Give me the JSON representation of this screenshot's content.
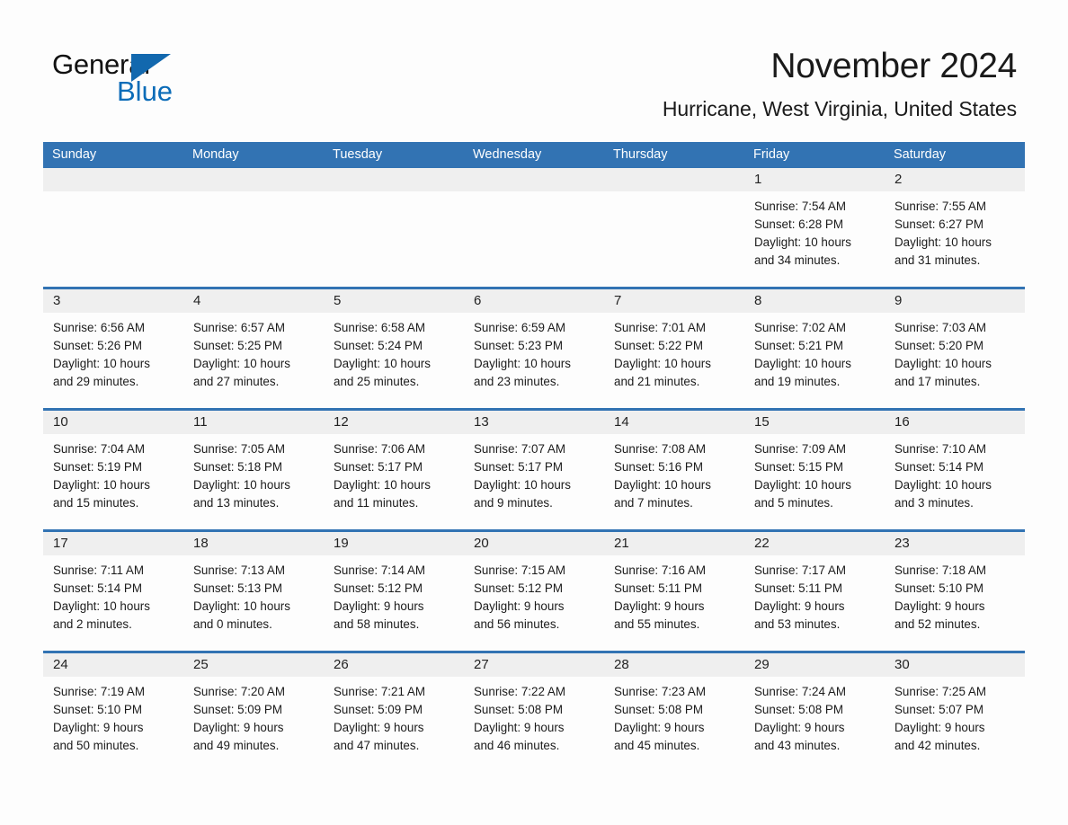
{
  "brand": {
    "name_part1": "General",
    "name_part2": "Blue",
    "accent_color": "#1268ae",
    "triangle_icon": "triangle-icon"
  },
  "header": {
    "month_title": "November 2024",
    "location": "Hurricane, West Virginia, United States"
  },
  "theme": {
    "header_blue": "#3273b3",
    "daynum_band": "#efefef",
    "page_background": "#fdfdfd"
  },
  "weekdays": [
    "Sunday",
    "Monday",
    "Tuesday",
    "Wednesday",
    "Thursday",
    "Friday",
    "Saturday"
  ],
  "weeks": [
    [
      {
        "empty": true
      },
      {
        "empty": true
      },
      {
        "empty": true
      },
      {
        "empty": true
      },
      {
        "empty": true
      },
      {
        "day": "1",
        "sunrise": "Sunrise: 7:54 AM",
        "sunset": "Sunset: 6:28 PM",
        "daylight_line1": "Daylight: 10 hours",
        "daylight_line2": "and 34 minutes."
      },
      {
        "day": "2",
        "sunrise": "Sunrise: 7:55 AM",
        "sunset": "Sunset: 6:27 PM",
        "daylight_line1": "Daylight: 10 hours",
        "daylight_line2": "and 31 minutes."
      }
    ],
    [
      {
        "day": "3",
        "sunrise": "Sunrise: 6:56 AM",
        "sunset": "Sunset: 5:26 PM",
        "daylight_line1": "Daylight: 10 hours",
        "daylight_line2": "and 29 minutes."
      },
      {
        "day": "4",
        "sunrise": "Sunrise: 6:57 AM",
        "sunset": "Sunset: 5:25 PM",
        "daylight_line1": "Daylight: 10 hours",
        "daylight_line2": "and 27 minutes."
      },
      {
        "day": "5",
        "sunrise": "Sunrise: 6:58 AM",
        "sunset": "Sunset: 5:24 PM",
        "daylight_line1": "Daylight: 10 hours",
        "daylight_line2": "and 25 minutes."
      },
      {
        "day": "6",
        "sunrise": "Sunrise: 6:59 AM",
        "sunset": "Sunset: 5:23 PM",
        "daylight_line1": "Daylight: 10 hours",
        "daylight_line2": "and 23 minutes."
      },
      {
        "day": "7",
        "sunrise": "Sunrise: 7:01 AM",
        "sunset": "Sunset: 5:22 PM",
        "daylight_line1": "Daylight: 10 hours",
        "daylight_line2": "and 21 minutes."
      },
      {
        "day": "8",
        "sunrise": "Sunrise: 7:02 AM",
        "sunset": "Sunset: 5:21 PM",
        "daylight_line1": "Daylight: 10 hours",
        "daylight_line2": "and 19 minutes."
      },
      {
        "day": "9",
        "sunrise": "Sunrise: 7:03 AM",
        "sunset": "Sunset: 5:20 PM",
        "daylight_line1": "Daylight: 10 hours",
        "daylight_line2": "and 17 minutes."
      }
    ],
    [
      {
        "day": "10",
        "sunrise": "Sunrise: 7:04 AM",
        "sunset": "Sunset: 5:19 PM",
        "daylight_line1": "Daylight: 10 hours",
        "daylight_line2": "and 15 minutes."
      },
      {
        "day": "11",
        "sunrise": "Sunrise: 7:05 AM",
        "sunset": "Sunset: 5:18 PM",
        "daylight_line1": "Daylight: 10 hours",
        "daylight_line2": "and 13 minutes."
      },
      {
        "day": "12",
        "sunrise": "Sunrise: 7:06 AM",
        "sunset": "Sunset: 5:17 PM",
        "daylight_line1": "Daylight: 10 hours",
        "daylight_line2": "and 11 minutes."
      },
      {
        "day": "13",
        "sunrise": "Sunrise: 7:07 AM",
        "sunset": "Sunset: 5:17 PM",
        "daylight_line1": "Daylight: 10 hours",
        "daylight_line2": "and 9 minutes."
      },
      {
        "day": "14",
        "sunrise": "Sunrise: 7:08 AM",
        "sunset": "Sunset: 5:16 PM",
        "daylight_line1": "Daylight: 10 hours",
        "daylight_line2": "and 7 minutes."
      },
      {
        "day": "15",
        "sunrise": "Sunrise: 7:09 AM",
        "sunset": "Sunset: 5:15 PM",
        "daylight_line1": "Daylight: 10 hours",
        "daylight_line2": "and 5 minutes."
      },
      {
        "day": "16",
        "sunrise": "Sunrise: 7:10 AM",
        "sunset": "Sunset: 5:14 PM",
        "daylight_line1": "Daylight: 10 hours",
        "daylight_line2": "and 3 minutes."
      }
    ],
    [
      {
        "day": "17",
        "sunrise": "Sunrise: 7:11 AM",
        "sunset": "Sunset: 5:14 PM",
        "daylight_line1": "Daylight: 10 hours",
        "daylight_line2": "and 2 minutes."
      },
      {
        "day": "18",
        "sunrise": "Sunrise: 7:13 AM",
        "sunset": "Sunset: 5:13 PM",
        "daylight_line1": "Daylight: 10 hours",
        "daylight_line2": "and 0 minutes."
      },
      {
        "day": "19",
        "sunrise": "Sunrise: 7:14 AM",
        "sunset": "Sunset: 5:12 PM",
        "daylight_line1": "Daylight: 9 hours",
        "daylight_line2": "and 58 minutes."
      },
      {
        "day": "20",
        "sunrise": "Sunrise: 7:15 AM",
        "sunset": "Sunset: 5:12 PM",
        "daylight_line1": "Daylight: 9 hours",
        "daylight_line2": "and 56 minutes."
      },
      {
        "day": "21",
        "sunrise": "Sunrise: 7:16 AM",
        "sunset": "Sunset: 5:11 PM",
        "daylight_line1": "Daylight: 9 hours",
        "daylight_line2": "and 55 minutes."
      },
      {
        "day": "22",
        "sunrise": "Sunrise: 7:17 AM",
        "sunset": "Sunset: 5:11 PM",
        "daylight_line1": "Daylight: 9 hours",
        "daylight_line2": "and 53 minutes."
      },
      {
        "day": "23",
        "sunrise": "Sunrise: 7:18 AM",
        "sunset": "Sunset: 5:10 PM",
        "daylight_line1": "Daylight: 9 hours",
        "daylight_line2": "and 52 minutes."
      }
    ],
    [
      {
        "day": "24",
        "sunrise": "Sunrise: 7:19 AM",
        "sunset": "Sunset: 5:10 PM",
        "daylight_line1": "Daylight: 9 hours",
        "daylight_line2": "and 50 minutes."
      },
      {
        "day": "25",
        "sunrise": "Sunrise: 7:20 AM",
        "sunset": "Sunset: 5:09 PM",
        "daylight_line1": "Daylight: 9 hours",
        "daylight_line2": "and 49 minutes."
      },
      {
        "day": "26",
        "sunrise": "Sunrise: 7:21 AM",
        "sunset": "Sunset: 5:09 PM",
        "daylight_line1": "Daylight: 9 hours",
        "daylight_line2": "and 47 minutes."
      },
      {
        "day": "27",
        "sunrise": "Sunrise: 7:22 AM",
        "sunset": "Sunset: 5:08 PM",
        "daylight_line1": "Daylight: 9 hours",
        "daylight_line2": "and 46 minutes."
      },
      {
        "day": "28",
        "sunrise": "Sunrise: 7:23 AM",
        "sunset": "Sunset: 5:08 PM",
        "daylight_line1": "Daylight: 9 hours",
        "daylight_line2": "and 45 minutes."
      },
      {
        "day": "29",
        "sunrise": "Sunrise: 7:24 AM",
        "sunset": "Sunset: 5:08 PM",
        "daylight_line1": "Daylight: 9 hours",
        "daylight_line2": "and 43 minutes."
      },
      {
        "day": "30",
        "sunrise": "Sunrise: 7:25 AM",
        "sunset": "Sunset: 5:07 PM",
        "daylight_line1": "Daylight: 9 hours",
        "daylight_line2": "and 42 minutes."
      }
    ]
  ]
}
